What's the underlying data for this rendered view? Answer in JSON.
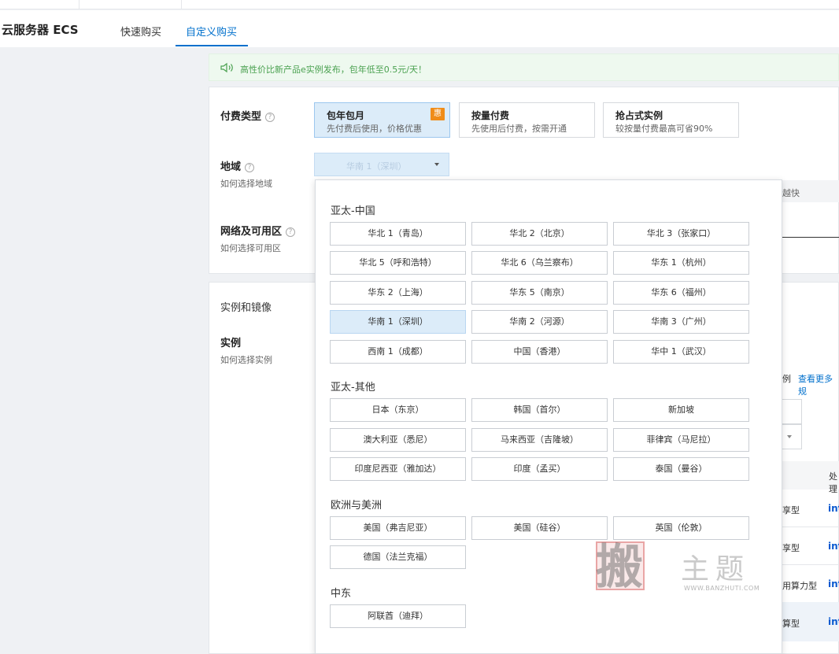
{
  "header": {
    "title": "云服务器 ECS",
    "tabs": [
      {
        "label": "快速购买"
      },
      {
        "label": "自定义购买"
      }
    ]
  },
  "notice": {
    "icon": "speaker-icon",
    "text": "高性价比新产品e实例发布，包年低至0.5元/天！"
  },
  "billing": {
    "label": "付费类型",
    "help": "?",
    "options": [
      {
        "title": "包年包月",
        "desc": "先付费后使用，价格优惠",
        "badge": "惠"
      },
      {
        "title": "按量付费",
        "desc": "先使用后付费，按需开通"
      },
      {
        "title": "抢占式实例",
        "desc": "较按量付费最高可省90%"
      }
    ]
  },
  "region": {
    "label": "地域",
    "help": "?",
    "sublabel": "如何选择地域",
    "selected": "华南 1（深圳）"
  },
  "network": {
    "label": "网络及可用区",
    "help": "?",
    "sublabel": "如何选择可用区"
  },
  "instance_section": {
    "title": "实例和镜像",
    "label": "实例",
    "sublabel": "如何选择实例"
  },
  "background": {
    "tip_fragment": "越快",
    "link_fragment_1": "例",
    "link_fragment_2": "查看更多规",
    "col_header_fragment": "处理",
    "rows": [
      {
        "type": "享型",
        "cpu": "inte"
      },
      {
        "type": "享型",
        "cpu": "inte"
      },
      {
        "type": "用算力型",
        "cpu": "inte"
      },
      {
        "type": "算型",
        "cpu": "inte"
      }
    ]
  },
  "dropdown": {
    "groups": [
      {
        "title": "亚太-中国",
        "regions": [
          "华北 1（青岛）",
          "华北 2（北京）",
          "华北 3（张家口）",
          "华北 5（呼和浩特）",
          "华北 6（乌兰察布）",
          "华东 1（杭州）",
          "华东 2（上海）",
          "华东 5（南京）",
          "华东 6（福州）",
          "华南 1（深圳）",
          "华南 2（河源）",
          "华南 3（广州）",
          "西南 1（成都）",
          "中国（香港）",
          "华中 1（武汉）"
        ]
      },
      {
        "title": "亚太-其他",
        "regions": [
          "日本（东京）",
          "韩国（首尔）",
          "新加坡",
          "澳大利亚（悉尼）",
          "马来西亚（吉隆坡）",
          "菲律宾（马尼拉）",
          "印度尼西亚（雅加达）",
          "印度（孟买）",
          "泰国（曼谷）"
        ]
      },
      {
        "title": "欧洲与美洲",
        "regions": [
          "美国（弗吉尼亚）",
          "美国（硅谷）",
          "英国（伦敦）",
          "德国（法兰克福）"
        ]
      },
      {
        "title": "中东",
        "regions": [
          "阿联酋（迪拜）"
        ]
      }
    ]
  },
  "watermark": {
    "seal_char": "搬",
    "text": "主题",
    "url": "WWW.BANZHUTI.COM"
  },
  "colors": {
    "accent": "#0070cc",
    "selected_bg": "#dcecf9",
    "notice_bg": "#eef9ef",
    "notice_text": "#4aa150",
    "badge": "#f08c18"
  }
}
